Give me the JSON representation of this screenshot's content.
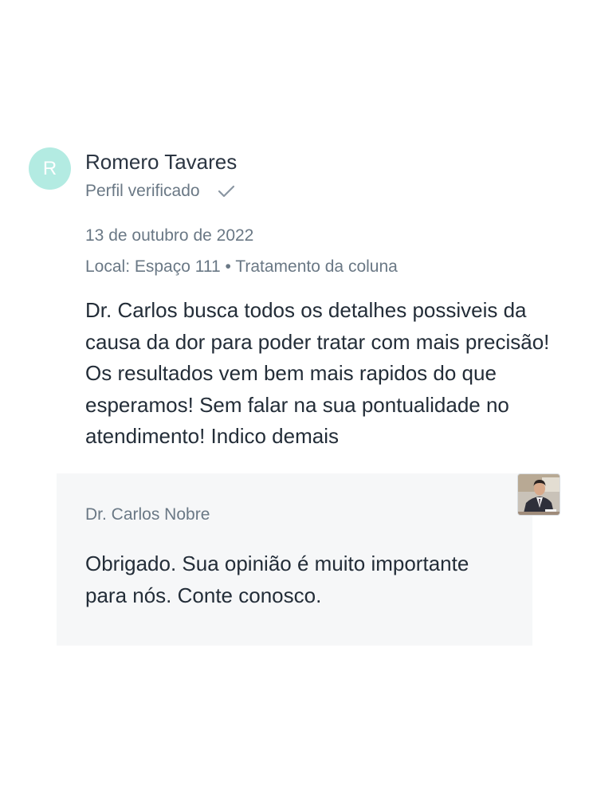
{
  "review": {
    "avatar_initial": "R",
    "reviewer_name": "Romero Tavares",
    "verified_label": "Perfil verificado",
    "date": "13 de outubro de 2022",
    "location": "Local: Espaço 111 • Tratamento da coluna",
    "text": "Dr. Carlos busca todos os detalhes possiveis da causa da dor para poder tratar com mais precisão! Os resultados vem bem mais rapidos do que esperamos! Sem falar na sua pontualidade no atendimento! Indico demais",
    "avatar_color": "#b3ebe2",
    "verified_icon": "checkmark-icon"
  },
  "reply": {
    "author": "Dr. Carlos Nobre",
    "text": "Obrigado. Sua opinião é muito importante para nós. Conte conosco.",
    "background_color": "#f6f7f8",
    "photo_icon": "doctor-photo"
  }
}
